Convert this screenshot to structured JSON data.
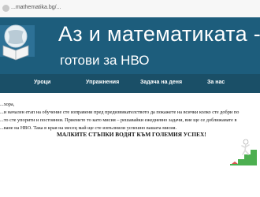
{
  "browser": {
    "url": "...mathematika.bg/..."
  },
  "banner": {
    "title": "Аз и математиката -",
    "subtitle": "готови за НВО",
    "logo_icon": "book-globe-logo"
  },
  "nav": {
    "items": [
      {
        "label": "Уроци"
      },
      {
        "label": "Упражнения"
      },
      {
        "label": "Задача на деня"
      },
      {
        "label": "За нас"
      }
    ]
  },
  "content": {
    "greeting": "...хора,",
    "lines": [
      "...и началeн етап на обучение сте изправени пред предизвикателството да покажете на всички колко сте добри по",
      "...то сте упорити и постоянни. Приемете то като мисия – решавайки ежедневно задачи, вие ще се доближавате в",
      "...ване на НВО. Така в края на месец май ще сте изпълнили успешно вашата мисия."
    ],
    "slogan": "МАЛКИТЕ СТЪПКИ ВОДЯТ КЪМ ГОЛЕМИЯ УСПЕХ!"
  },
  "colors": {
    "banner": "#1d5d7c",
    "nav": "#1a4f67",
    "text": "#111111"
  },
  "illustration": {
    "icon": "climbing-stairs-figure"
  }
}
